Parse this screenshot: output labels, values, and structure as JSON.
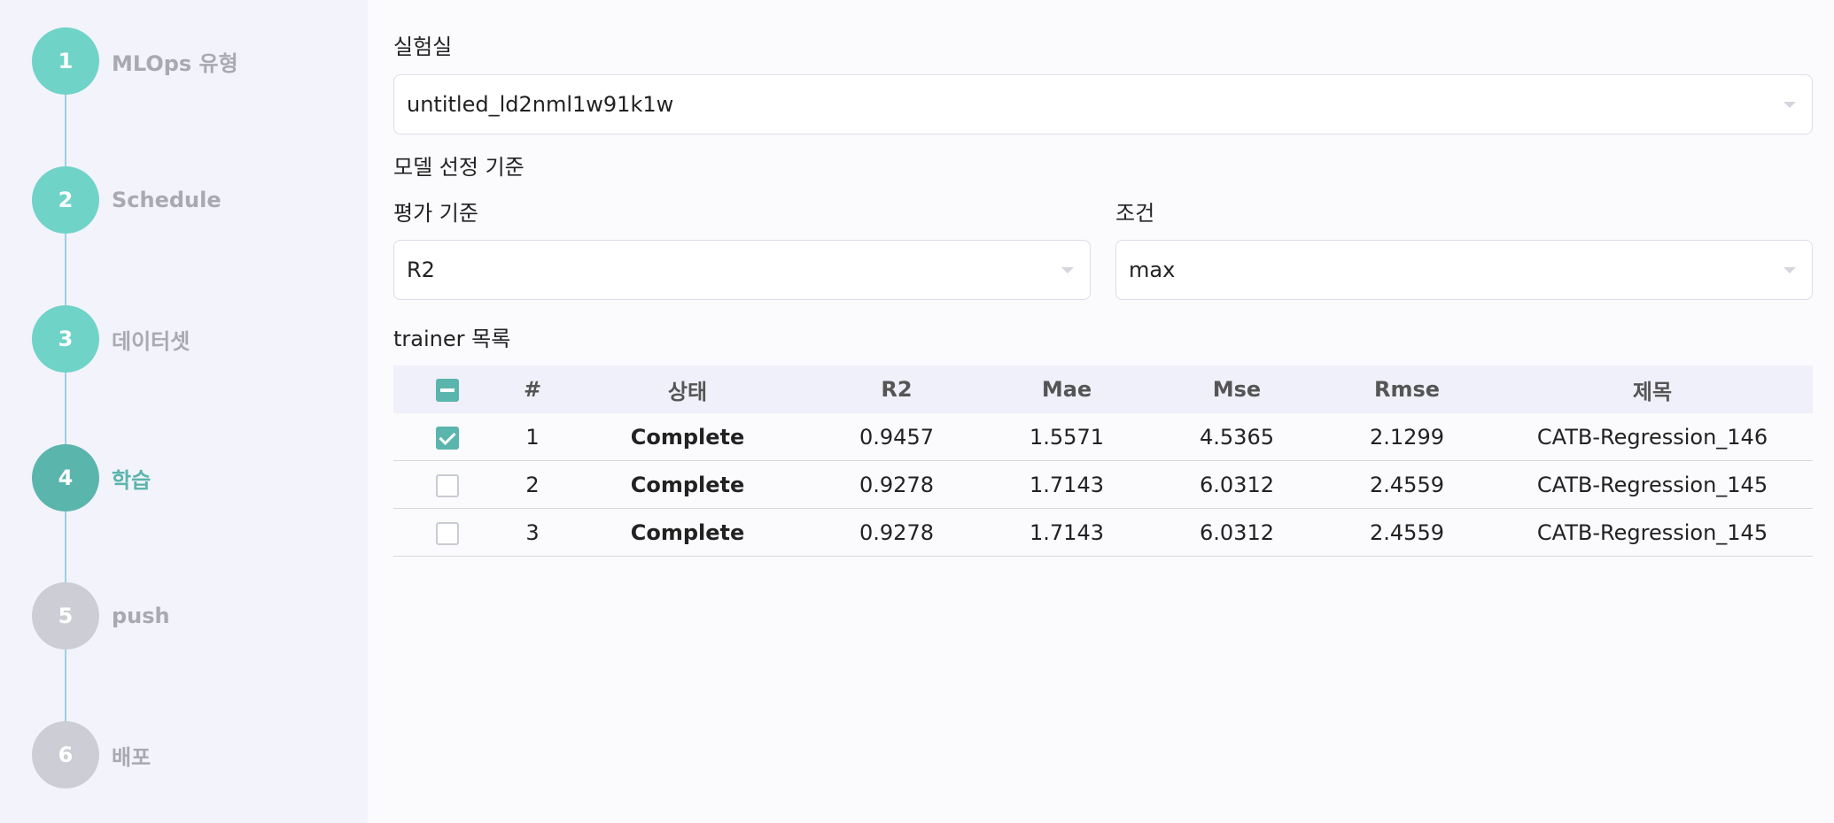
{
  "steps": [
    {
      "number": "1",
      "label": "MLOps 유형",
      "state": "done"
    },
    {
      "number": "2",
      "label": "Schedule",
      "state": "done"
    },
    {
      "number": "3",
      "label": "데이터셋",
      "state": "done"
    },
    {
      "number": "4",
      "label": "학습",
      "state": "active"
    },
    {
      "number": "5",
      "label": "push",
      "state": "todo"
    },
    {
      "number": "6",
      "label": "배포",
      "state": "todo"
    }
  ],
  "experiment": {
    "label": "실험실",
    "value": "untitled_ld2nml1w91k1w"
  },
  "model_selection": {
    "label": "모델 선정 기준",
    "metric_label": "평가 기준",
    "metric_value": "R2",
    "condition_label": "조건",
    "condition_value": "max"
  },
  "trainers": {
    "label": "trainer 목록",
    "columns": {
      "index": "#",
      "status": "상태",
      "r2": "R2",
      "mae": "Mae",
      "mse": "Mse",
      "rmse": "Rmse",
      "title": "제목"
    },
    "rows": [
      {
        "checked": true,
        "index": "1",
        "status": "Complete",
        "r2": "0.9457",
        "mae": "1.5571",
        "mse": "4.5365",
        "rmse": "2.1299",
        "title": "CATB-Regression_146"
      },
      {
        "checked": false,
        "index": "2",
        "status": "Complete",
        "r2": "0.9278",
        "mae": "1.7143",
        "mse": "6.0312",
        "rmse": "2.4559",
        "title": "CATB-Regression_145"
      },
      {
        "checked": false,
        "index": "3",
        "status": "Complete",
        "r2": "0.9278",
        "mae": "1.7143",
        "mse": "6.0312",
        "rmse": "2.4559",
        "title": "CATB-Regression_145"
      }
    ]
  },
  "colors": {
    "step_done": "#6fd3c8",
    "step_active": "#5ab5ad",
    "step_todo": "#cdcdd6",
    "status_complete": "#4e9f6c"
  }
}
